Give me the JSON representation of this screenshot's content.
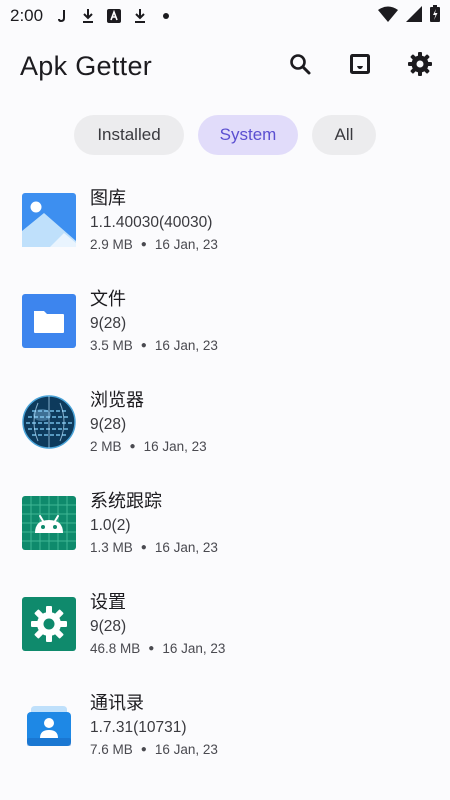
{
  "status_bar": {
    "time": "2:00",
    "left_icons": [
      "notification-icon",
      "download-icon",
      "a-icon",
      "download-icon",
      "dot-icon"
    ],
    "right_icons": [
      "wifi-icon",
      "signal-icon",
      "battery-icon"
    ]
  },
  "app_bar": {
    "title": "Apk Getter",
    "actions": [
      "search-icon",
      "inbox-icon",
      "settings-icon"
    ]
  },
  "filters": [
    {
      "label": "Installed",
      "selected": false
    },
    {
      "label": "System",
      "selected": true
    },
    {
      "label": "All",
      "selected": false
    }
  ],
  "apps": [
    {
      "name": "图库",
      "version": "1.1.40030(40030)",
      "size": "2.9 MB",
      "date": "16 Jan, 23",
      "icon": "gallery-icon"
    },
    {
      "name": "文件",
      "version": "9(28)",
      "size": "3.5 MB",
      "date": "16 Jan, 23",
      "icon": "files-icon"
    },
    {
      "name": "浏览器",
      "version": "9(28)",
      "size": "2 MB",
      "date": "16 Jan, 23",
      "icon": "browser-icon"
    },
    {
      "name": "系统跟踪",
      "version": "1.0(2)",
      "size": "1.3 MB",
      "date": "16 Jan, 23",
      "icon": "android-icon"
    },
    {
      "name": "设置",
      "version": "9(28)",
      "size": "46.8 MB",
      "date": "16 Jan, 23",
      "icon": "settings-app-icon"
    },
    {
      "name": "通讯录",
      "version": "1.7.31(10731)",
      "size": "7.6 MB",
      "date": "16 Jan, 23",
      "icon": "contacts-icon"
    }
  ],
  "colors": {
    "accent": "#5b4fd1",
    "chip_selected_bg": "#e1dcfa",
    "chip_bg": "#ececee"
  }
}
